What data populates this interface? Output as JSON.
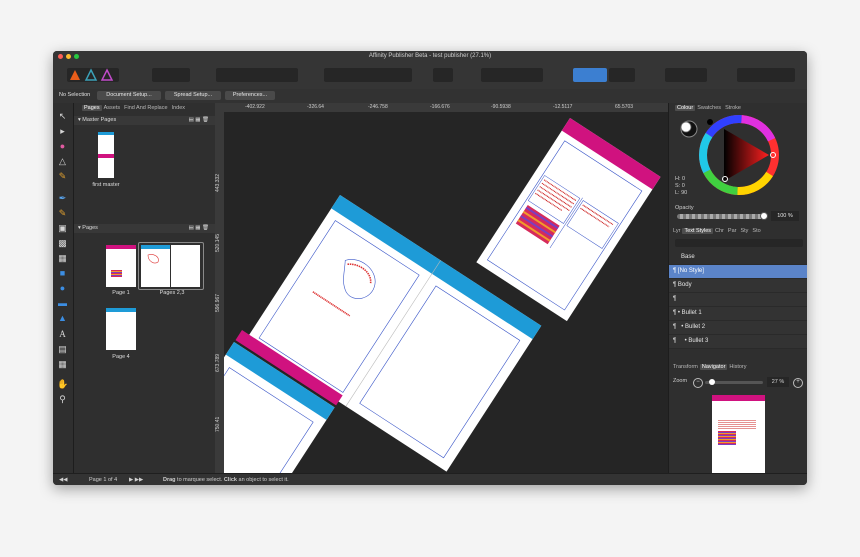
{
  "window": {
    "title": "Affinity Publisher Beta - test publisher (27.1%)"
  },
  "context_bar": {
    "selection": "No Selection",
    "document_setup": "Document Setup...",
    "spread_setup": "Spread Setup...",
    "preferences": "Preferences..."
  },
  "left_panel": {
    "tabs": [
      "Pages",
      "Assets",
      "Find And Replace",
      "Index"
    ],
    "master_pages_label": "Master Pages",
    "master_name": "first master",
    "pages_label": "Pages",
    "pages": [
      "Page 1",
      "Pages 2,3",
      "Page 4"
    ]
  },
  "rulers": {
    "h": [
      "-402.922",
      "-326.64",
      "-246.758",
      "-166.676",
      "-90.5938",
      "-12.5117",
      "65.5703"
    ],
    "v": [
      "443.332",
      "520.145",
      "596.967",
      "673.789",
      "750.41"
    ]
  },
  "colour_panel": {
    "tabs": [
      "Colour",
      "Swatches",
      "Stroke"
    ],
    "h": "H: 0",
    "s": "S: 0",
    "l": "L: 90",
    "opacity_label": "Opacity",
    "opacity_value": "100 %"
  },
  "text_styles": {
    "tabs": [
      "Lyr",
      "Text Styles",
      "Chr",
      "Par",
      "Sty",
      "Sto"
    ],
    "rows": [
      "Base",
      "[No Style]",
      "Body",
      "",
      "Bullet 1",
      "Bullet 2",
      "Bullet 3"
    ]
  },
  "navigator": {
    "tabs": [
      "Transform",
      "Navigator",
      "History"
    ],
    "zoom_label": "Zoom",
    "zoom_value": "27 %"
  },
  "status": {
    "page": "Page 1 of 4",
    "hint_drag": "Drag",
    "hint_rest1": " to marquee select. ",
    "hint_click": "Click",
    "hint_rest2": " an object to select it."
  },
  "colors": {
    "accent": "#3c7fd1",
    "magenta": "#d0127f",
    "cyan": "#1e9bd7"
  }
}
